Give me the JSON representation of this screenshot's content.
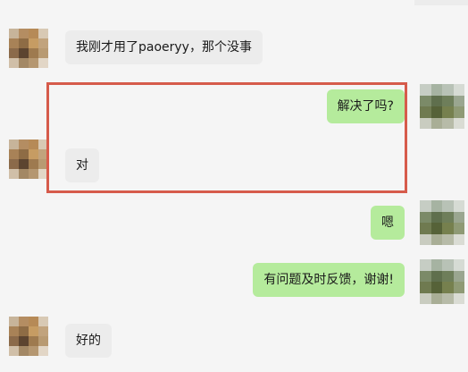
{
  "messages": [
    {
      "side": "in",
      "text": "我刚才用了paoeryy，那个没事"
    },
    {
      "side": "out",
      "text": "解决了吗?"
    },
    {
      "side": "in",
      "text": "对"
    },
    {
      "side": "out",
      "text": "嗯"
    },
    {
      "side": "out",
      "text": "有问题及时反馈，谢谢!"
    },
    {
      "side": "in",
      "text": "好的"
    }
  ],
  "colors": {
    "incoming_bubble": "#ececec",
    "outgoing_bubble": "#b5eb9c",
    "highlight_border": "#d65b4b",
    "background": "#f5f5f5"
  }
}
